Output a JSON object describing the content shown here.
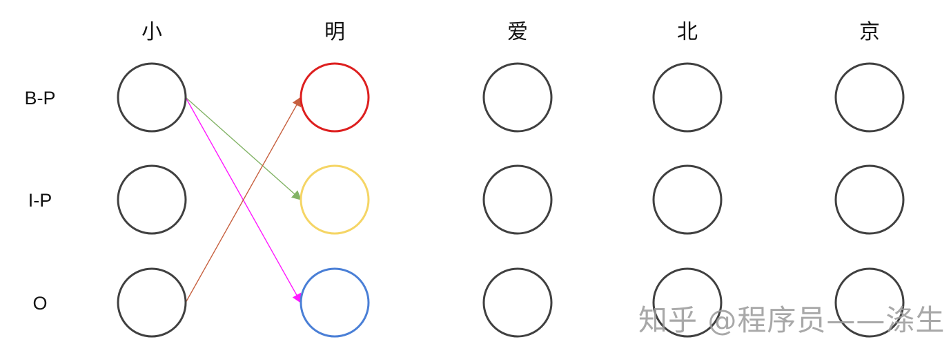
{
  "columns": [
    "小",
    "明",
    "爱",
    "北",
    "京"
  ],
  "rows": [
    "B-P",
    "I-P",
    "O"
  ],
  "colors": {
    "default_node": "#404040",
    "b_p_highlight": "#dd1f1f",
    "i_p_highlight": "#f5d565",
    "o_highlight": "#4a7fd6",
    "edge_o_to_bp": "#c7603f",
    "edge_bp_to_ip": "#82b366",
    "edge_bp_to_o": "#ff19ff"
  },
  "highlights": [
    {
      "col": 1,
      "row": 0,
      "color": "#dd1f1f"
    },
    {
      "col": 1,
      "row": 1,
      "color": "#f5d565"
    },
    {
      "col": 1,
      "row": 2,
      "color": "#4a7fd6"
    }
  ],
  "edges": [
    {
      "from": {
        "col": 0,
        "row": 0
      },
      "to": {
        "col": 1,
        "row": 1
      },
      "color": "#82b366"
    },
    {
      "from": {
        "col": 0,
        "row": 0
      },
      "to": {
        "col": 1,
        "row": 2
      },
      "color": "#ff19ff"
    },
    {
      "from": {
        "col": 0,
        "row": 2
      },
      "to": {
        "col": 1,
        "row": 0
      },
      "color": "#c7603f"
    }
  ],
  "watermark": "知乎 @程序员——涤生"
}
